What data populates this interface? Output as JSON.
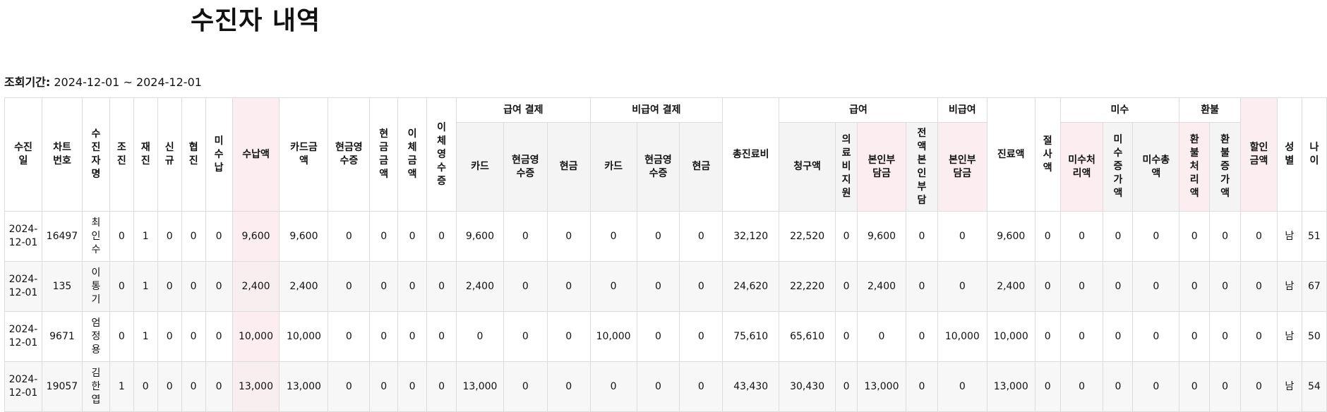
{
  "title": "수진자 내역",
  "period": {
    "label": "조회기간:",
    "value": "2024-12-01 ~ 2024-12-01"
  },
  "headers": {
    "date": "수진\n일",
    "chart_no": "차트\n번호",
    "patient_name": "수\n진\n자\n명",
    "cho": "조\n진",
    "jae": "재\n진",
    "new": "신\n규",
    "hyup": "협\n진",
    "unpaid": "미\n수\n납",
    "paid_amt": "수납액",
    "card_amt": "카드금\n액",
    "cash_receipt": "현금영\n수증",
    "cash_amt": "현\n금\n금\n액",
    "transfer_amt": "이\n체\n금\n액",
    "transfer_receipt": "이\n체\n영\n수\n증",
    "group_benefit_pay": "급여 결제",
    "group_nonbenefit_pay": "비급여 결제",
    "bp_card": "카드",
    "bp_cash_receipt": "현금영\n수증",
    "bp_cash": "현금",
    "nbp_card": "카드",
    "nbp_cash_receipt": "현금영\n수증",
    "nbp_cash": "현금",
    "total_fee": "총진료비",
    "group_benefit": "급여",
    "claim": "청구액",
    "medical_aid": "의\n료\n비\n지\n원",
    "copay": "본인부\n담금",
    "full_copay": "전\n액\n본\n인\n부\n담",
    "group_nonbenefit": "비급여",
    "nb_copay": "본인부\n담금",
    "treatment_amt": "진료액",
    "discount": "절\n사\n액",
    "group_unpaid": "미수",
    "unpaid_proc": "미수처\n리액",
    "unpaid_inc": "미\n수\n증\n가\n액",
    "unpaid_total": "미수총\n액",
    "group_refund": "환불",
    "refund_proc": "환\n불\n처\n리\n액",
    "refund_inc": "환\n불\n증\n가\n액",
    "discount_amt": "할인\n금액",
    "sex": "성\n별",
    "age": "나\n이"
  },
  "rows": [
    {
      "date": "2024-\n12-01",
      "chart_no": "16497",
      "name": "최\n인\n수",
      "cho": "0",
      "jae": "1",
      "new": "0",
      "hyup": "0",
      "unpaid": "0",
      "paid": "9,600",
      "card": "9,600",
      "cash_receipt": "0",
      "cash": "0",
      "transfer": "0",
      "transfer_receipt": "0",
      "bp_card": "9,600",
      "bp_cash_receipt": "0",
      "bp_cash": "0",
      "nbp_card": "0",
      "nbp_cash_receipt": "0",
      "nbp_cash": "0",
      "total_fee": "32,120",
      "claim": "22,520",
      "medical_aid": "0",
      "copay": "9,600",
      "full_copay": "0",
      "nb_copay": "0",
      "treatment": "9,600",
      "discount": "0",
      "unpaid_proc": "0",
      "unpaid_inc": "0",
      "unpaid_total": "0",
      "refund_proc": "0",
      "refund_inc": "0",
      "discount_amt": "0",
      "sex": "남",
      "age": "51"
    },
    {
      "date": "2024-\n12-01",
      "chart_no": "135",
      "name": "이\n통\n기",
      "cho": "0",
      "jae": "1",
      "new": "0",
      "hyup": "0",
      "unpaid": "0",
      "paid": "2,400",
      "card": "2,400",
      "cash_receipt": "0",
      "cash": "0",
      "transfer": "0",
      "transfer_receipt": "0",
      "bp_card": "2,400",
      "bp_cash_receipt": "0",
      "bp_cash": "0",
      "nbp_card": "0",
      "nbp_cash_receipt": "0",
      "nbp_cash": "0",
      "total_fee": "24,620",
      "claim": "22,220",
      "medical_aid": "0",
      "copay": "2,400",
      "full_copay": "0",
      "nb_copay": "0",
      "treatment": "2,400",
      "discount": "0",
      "unpaid_proc": "0",
      "unpaid_inc": "0",
      "unpaid_total": "0",
      "refund_proc": "0",
      "refund_inc": "0",
      "discount_amt": "0",
      "sex": "남",
      "age": "67"
    },
    {
      "date": "2024-\n12-01",
      "chart_no": "9671",
      "name": "엄\n정\n용",
      "cho": "0",
      "jae": "1",
      "new": "0",
      "hyup": "0",
      "unpaid": "0",
      "paid": "10,000",
      "card": "10,000",
      "cash_receipt": "0",
      "cash": "0",
      "transfer": "0",
      "transfer_receipt": "0",
      "bp_card": "0",
      "bp_cash_receipt": "0",
      "bp_cash": "0",
      "nbp_card": "10,000",
      "nbp_cash_receipt": "0",
      "nbp_cash": "0",
      "total_fee": "75,610",
      "claim": "65,610",
      "medical_aid": "0",
      "copay": "0",
      "full_copay": "0",
      "nb_copay": "10,000",
      "treatment": "10,000",
      "discount": "0",
      "unpaid_proc": "0",
      "unpaid_inc": "0",
      "unpaid_total": "0",
      "refund_proc": "0",
      "refund_inc": "0",
      "discount_amt": "0",
      "sex": "남",
      "age": "50"
    },
    {
      "date": "2024-\n12-01",
      "chart_no": "19057",
      "name": "김\n한\n엽",
      "cho": "1",
      "jae": "0",
      "new": "0",
      "hyup": "0",
      "unpaid": "0",
      "paid": "13,000",
      "card": "13,000",
      "cash_receipt": "0",
      "cash": "0",
      "transfer": "0",
      "transfer_receipt": "0",
      "bp_card": "13,000",
      "bp_cash_receipt": "0",
      "bp_cash": "0",
      "nbp_card": "0",
      "nbp_cash_receipt": "0",
      "nbp_cash": "0",
      "total_fee": "43,430",
      "claim": "30,430",
      "medical_aid": "0",
      "copay": "13,000",
      "full_copay": "0",
      "nb_copay": "0",
      "treatment": "13,000",
      "discount": "0",
      "unpaid_proc": "0",
      "unpaid_inc": "0",
      "unpaid_total": "0",
      "refund_proc": "0",
      "refund_inc": "0",
      "discount_amt": "0",
      "sex": "남",
      "age": "54"
    }
  ]
}
